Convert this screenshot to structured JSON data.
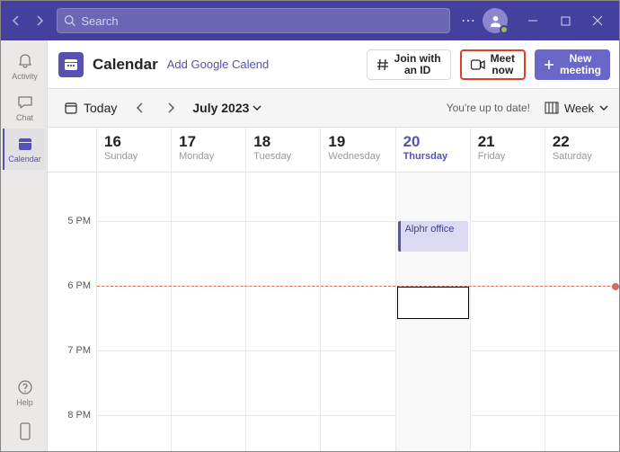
{
  "titlebar": {
    "search_placeholder": "Search"
  },
  "rail": {
    "activity": "Activity",
    "chat": "Chat",
    "calendar": "Calendar",
    "help": "Help"
  },
  "header": {
    "title": "Calendar",
    "add_google": "Add Google Calend",
    "join_id_l1": "Join with",
    "join_id_l2": "an ID",
    "meet_now_l1": "Meet",
    "meet_now_l2": "now",
    "new_meeting_l1": "New",
    "new_meeting_l2": "meeting"
  },
  "subbar": {
    "today": "Today",
    "month": "July 2023",
    "uptodate": "You're up to date!",
    "view": "Week"
  },
  "days": [
    {
      "num": "16",
      "dow": "Sunday"
    },
    {
      "num": "17",
      "dow": "Monday"
    },
    {
      "num": "18",
      "dow": "Tuesday"
    },
    {
      "num": "19",
      "dow": "Wednesday"
    },
    {
      "num": "20",
      "dow": "Thursday"
    },
    {
      "num": "21",
      "dow": "Friday"
    },
    {
      "num": "22",
      "dow": "Saturday"
    }
  ],
  "hours": [
    "5 PM",
    "6 PM",
    "7 PM",
    "8 PM"
  ],
  "event": {
    "title": "Alphr office"
  }
}
